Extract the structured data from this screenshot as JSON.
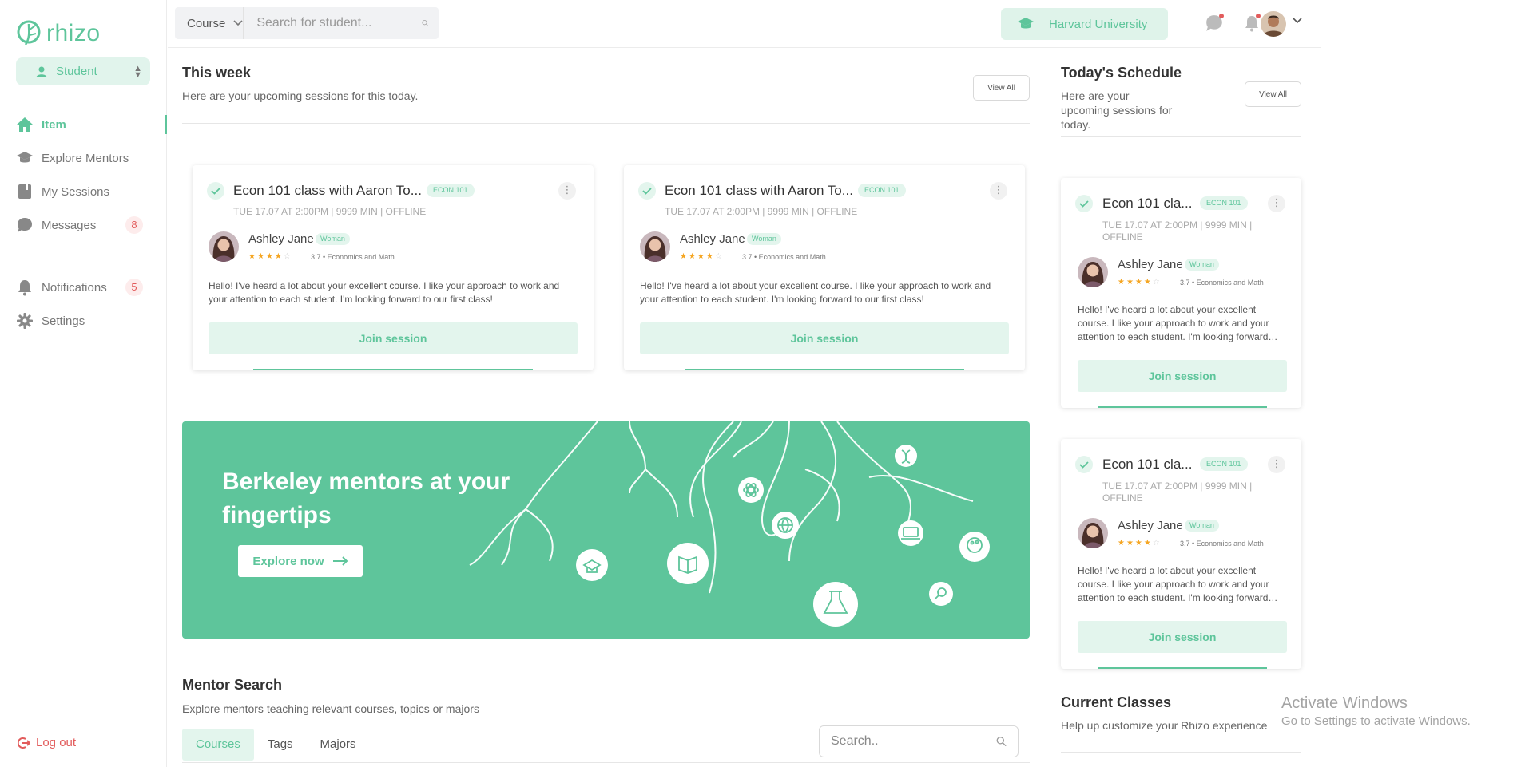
{
  "app": {
    "logo_text": "rhizo",
    "accent": "#5ec59b"
  },
  "sidebar": {
    "role": "Student",
    "items": [
      {
        "label": "Item",
        "icon": "home-icon",
        "active": true,
        "badge": ""
      },
      {
        "label": "Explore Mentors",
        "icon": "graduation-cap-icon",
        "active": false,
        "badge": ""
      },
      {
        "label": "My Sessions",
        "icon": "book-icon",
        "active": false,
        "badge": ""
      },
      {
        "label": "Messages",
        "icon": "chat-bubble-icon",
        "active": false,
        "badge": "8"
      }
    ],
    "items2": [
      {
        "label": "Notifications",
        "icon": "bell-icon",
        "badge": "5"
      },
      {
        "label": "Settings",
        "icon": "gear-icon",
        "badge": ""
      }
    ],
    "logout": "Log out"
  },
  "topbar": {
    "course_select": "Course",
    "search_placeholder": "Search for student...",
    "university": "Harvard University"
  },
  "this_week": {
    "title": "This week",
    "subtitle": "Here are your upcoming sessions for this today.",
    "view_all": "View All",
    "cards": [
      {
        "title": "Econ 101 class with Aaron To...",
        "tag": "ECON 101",
        "meta": "TUE 17.07 AT 2:00PM | 9999 MIN | OFFLINE",
        "mentor": "Ashley Jane",
        "gender": "Woman",
        "rating": "3.7 • Economics and Math",
        "message": "Hello! I've heard a lot about your excellent course. I like your approach to work and your attention to each student. I'm looking forward to our first class!",
        "button": "Join session"
      },
      {
        "title": "Econ 101 class with Aaron To...",
        "tag": "ECON 101",
        "meta": "TUE 17.07 AT 2:00PM | 9999 MIN | OFFLINE",
        "mentor": "Ashley Jane",
        "gender": "Woman",
        "rating": "3.7 • Economics and Math",
        "message": "Hello! I've heard a lot about your excellent course. I like your approach to work and your attention to each student. I'm looking forward to our first class!",
        "button": "Join session"
      }
    ]
  },
  "banner": {
    "title": "Berkeley mentors at your fingertips",
    "button": "Explore now"
  },
  "mentor_search": {
    "title": "Mentor Search",
    "subtitle": "Explore mentors teaching relevant courses, topics or majors",
    "tabs": [
      "Courses",
      "Tags",
      "Majors"
    ],
    "search_placeholder": "Search.."
  },
  "schedule": {
    "title": "Today's Schedule",
    "subtitle": "Here are your upcoming sessions for today.",
    "view_all": "View All",
    "cards": [
      {
        "title": "Econ 101 cla...",
        "tag": "ECON 101",
        "meta": "TUE 17.07 AT 2:00PM | 9999 MIN | OFFLINE",
        "mentor": "Ashley Jane",
        "gender": "Woman",
        "rating": "3.7 • Economics and Math",
        "message": "Hello! I've heard a lot about your excellent course. I like your approach to work and your attention to each student. I'm looking forward…",
        "button": "Join session"
      },
      {
        "title": "Econ 101 cla...",
        "tag": "ECON 101",
        "meta": "TUE 17.07 AT 2:00PM | 9999 MIN | OFFLINE",
        "mentor": "Ashley Jane",
        "gender": "Woman",
        "rating": "3.7 • Economics and Math",
        "message": "Hello! I've heard a lot about your excellent course. I like your approach to work and your attention to each student. I'm looking forward…",
        "button": "Join session"
      }
    ]
  },
  "current_classes": {
    "title": "Current Classes",
    "subtitle": "Help up customize your Rhizo experience"
  },
  "watermark": {
    "line1": "Activate Windows",
    "line2": "Go to Settings to activate Windows."
  }
}
